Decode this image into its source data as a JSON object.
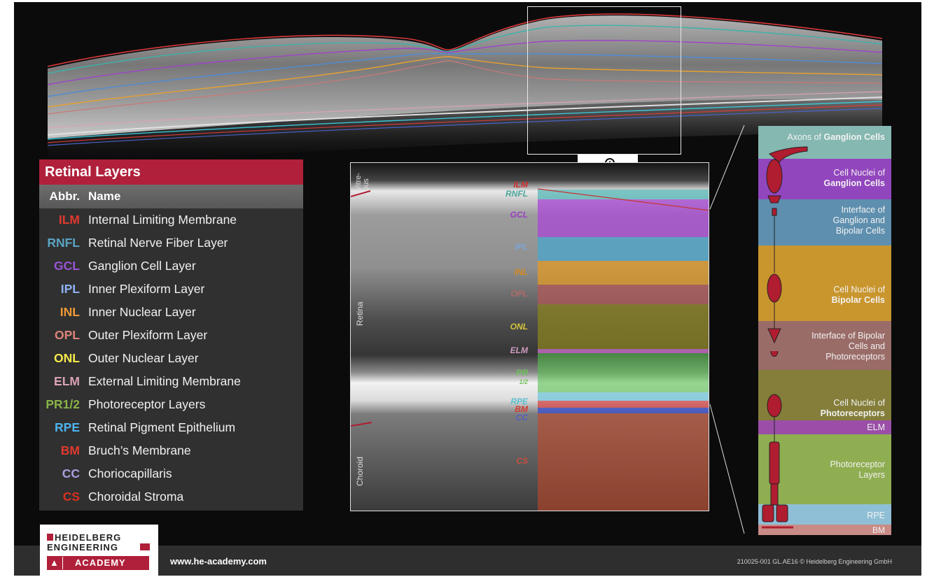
{
  "table": {
    "title": "Retinal Layers",
    "col_abbr": "Abbr.",
    "col_name": "Name",
    "rows": [
      {
        "abbr": "ILM",
        "name": "Internal Limiting Membrane",
        "color": "#e0392e"
      },
      {
        "abbr": "RNFL",
        "name": "Retinal Nerve Fiber Layer",
        "color": "#5aa4c4"
      },
      {
        "abbr": "GCL",
        "name": "Ganglion Cell Layer",
        "color": "#9a54d6"
      },
      {
        "abbr": "IPL",
        "name": "Inner Plexiform Layer",
        "color": "#8eb0f0"
      },
      {
        "abbr": "INL",
        "name": "Inner Nuclear Layer",
        "color": "#f09a36"
      },
      {
        "abbr": "OPL",
        "name": "Outer Plexiform Layer",
        "color": "#d9847a"
      },
      {
        "abbr": "ONL",
        "name": "Outer Nuclear Layer",
        "color": "#f5e94a"
      },
      {
        "abbr": "ELM",
        "name": "External Limiting Membrane",
        "color": "#d9a3b3"
      },
      {
        "abbr": "PR1/2",
        "name": "Photoreceptor Layers",
        "color": "#8ab446"
      },
      {
        "abbr": "RPE",
        "name": "Retinal Pigment Epithelium",
        "color": "#4fb3ee"
      },
      {
        "abbr": "BM",
        "name": "Bruch’s Membrane",
        "color": "#e0392e"
      },
      {
        "abbr": "CC",
        "name": "Choriocapillaris",
        "color": "#a8a0e0"
      },
      {
        "abbr": "CS",
        "name": "Choroidal Stroma",
        "color": "#d8301f"
      }
    ]
  },
  "zoom": {
    "labels": {
      "vitreous": "Vitre-\nous",
      "retina": "Retina",
      "choroid": "Choroid"
    },
    "tags": [
      {
        "text": "ILM",
        "color": "#c9302c"
      },
      {
        "text": "RNFL",
        "color": "#4aa69a"
      },
      {
        "text": "GCL",
        "color": "#9a3fc4"
      },
      {
        "text": "IPL",
        "color": "#7aa5d8"
      },
      {
        "text": "INL",
        "color": "#d68a20"
      },
      {
        "text": "OPL",
        "color": "#b06a6a"
      },
      {
        "text": "ONL",
        "color": "#d5c43c"
      },
      {
        "text": "ELM",
        "color": "#cf9cc0"
      },
      {
        "text": "PR",
        "color": "#6fc25a"
      },
      {
        "text": "1/2",
        "color": "#6fc25a"
      },
      {
        "text": "RPE",
        "color": "#58c0d0"
      },
      {
        "text": "BM",
        "color": "#d0392f"
      },
      {
        "text": "CC",
        "color": "#5560c0"
      },
      {
        "text": "CS",
        "color": "#c9503c"
      }
    ]
  },
  "schema": {
    "axons_pre": "Axons of ",
    "axons_bold": "Ganglion Cells",
    "gcl_pre": "Cell Nuclei of",
    "gcl_bold": "Ganglion Cells",
    "ipl": "Interface of\nGanglion and\nBipolar Cells",
    "inl_pre": "Cell Nuclei of",
    "inl_bold": "Bipolar Cells",
    "opl": "Interface of Bipolar\nCells and\nPhotoreceptors",
    "onl_pre": "Cell Nuclei of",
    "onl_bold": "Photoreceptors",
    "elm": "ELM",
    "pr": "Photoreceptor\nLayers",
    "rpe": "RPE",
    "bm": "BM"
  },
  "logo": {
    "line1": "HEIDELBERG",
    "line2": "ENGINEERING",
    "line3": "ACADEMY"
  },
  "footer": {
    "website": "www.he-academy.com",
    "copyright": "210025-001 GL.AE16 © Heidelberg Engineering GmbH"
  },
  "colors": {
    "brand_red": "#b0203a"
  }
}
